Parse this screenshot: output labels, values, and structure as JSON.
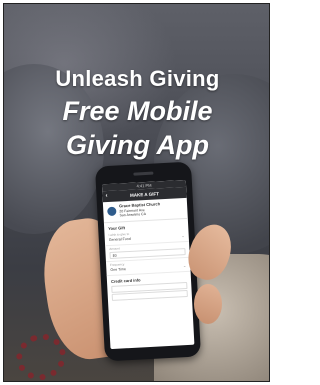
{
  "headline": {
    "line1": "Unleash Giving",
    "line2": "Free Mobile",
    "line3": "Giving App"
  },
  "phone": {
    "status_time": "4:41 PM",
    "nav_title": "MAKE A GIFT",
    "back_icon": "chevron-left-icon",
    "church": {
      "name": "Grace Baptist Church",
      "address_line1": "20 Fairmont Ave",
      "address_line2": "San Anselmo CA"
    },
    "section_title": "Your Gift",
    "fields": [
      {
        "label": "I wish to give to",
        "value": "General Fund"
      },
      {
        "label": "Amount",
        "value": "$0"
      },
      {
        "label": "Frequency",
        "value": "One Time"
      }
    ],
    "card_section_title": "Credit card info"
  }
}
